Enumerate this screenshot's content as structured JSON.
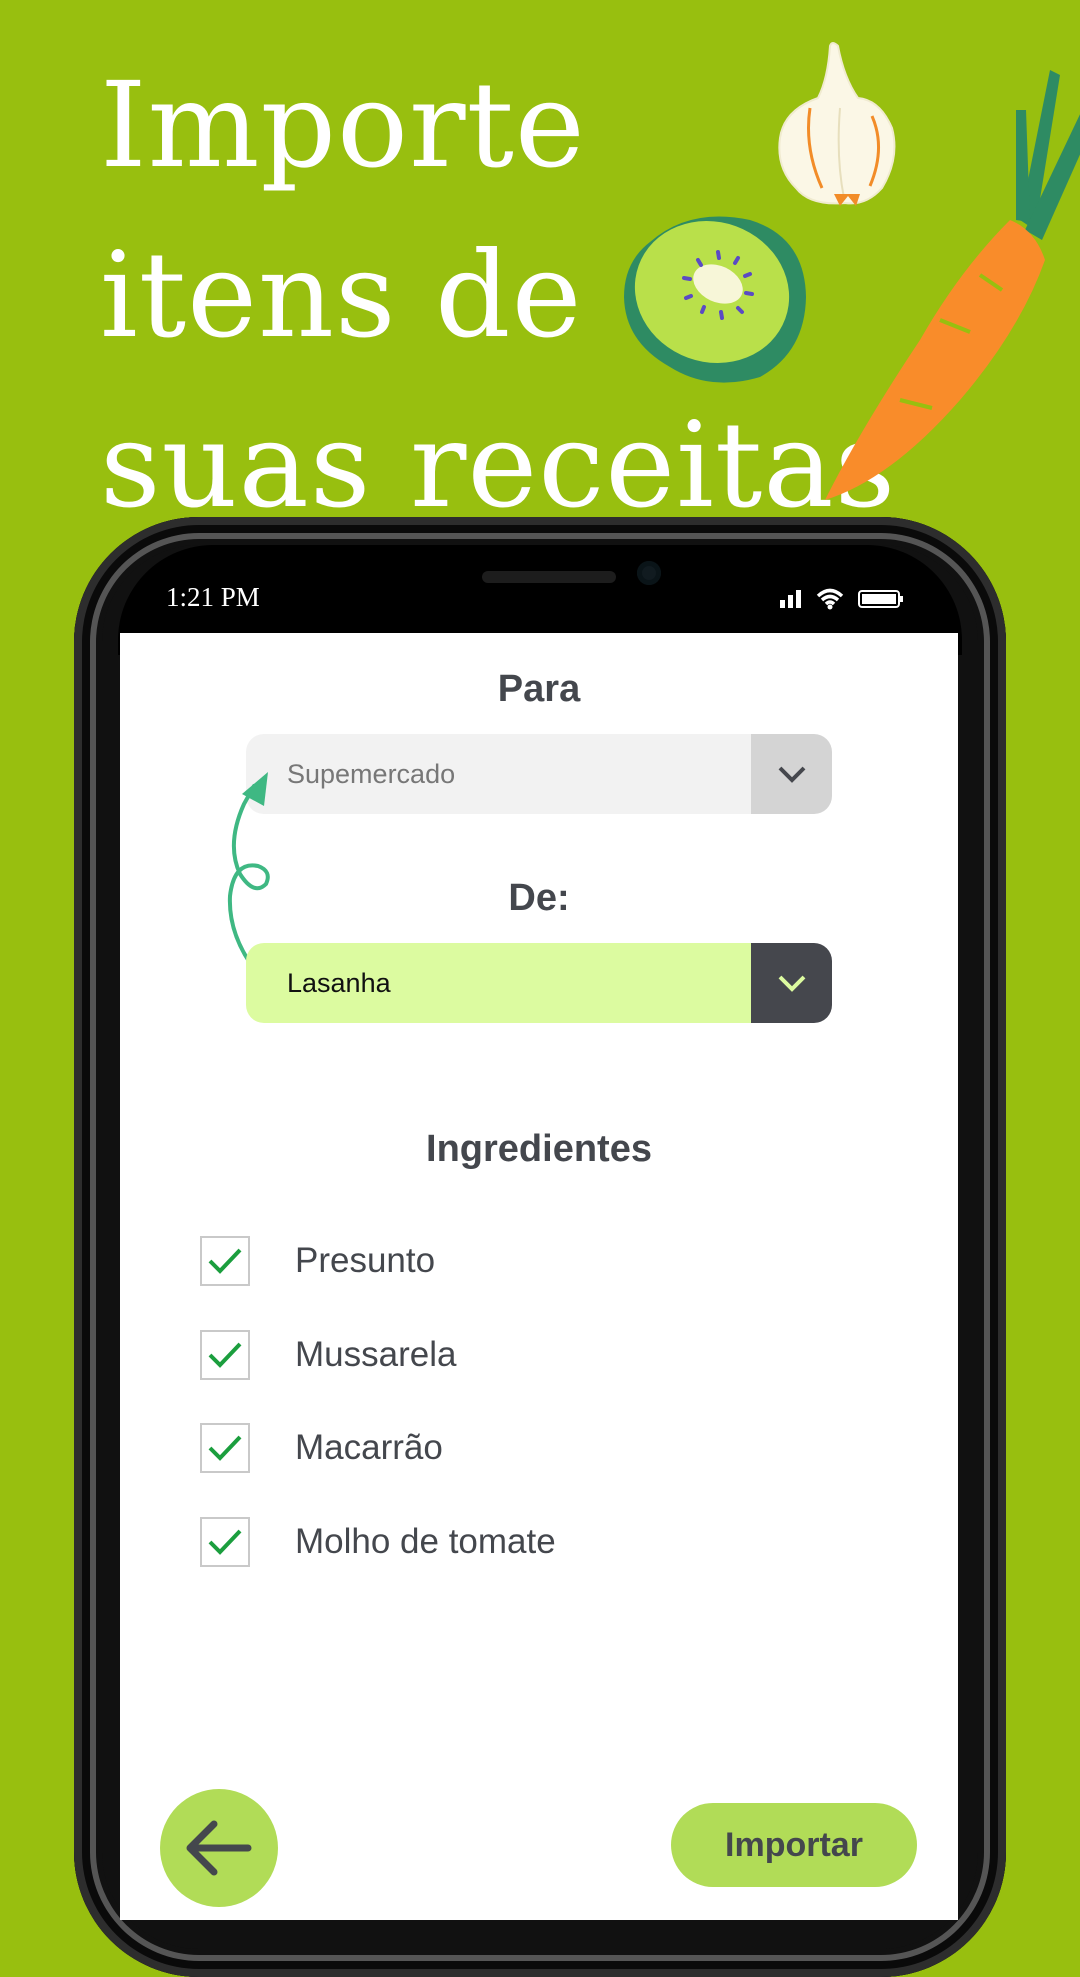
{
  "headline": {
    "line1": "Importe",
    "line2": "itens de",
    "line3": "suas receitas"
  },
  "status_bar": {
    "time": "1:21 PM"
  },
  "form": {
    "to_label": "Para",
    "to_value": "Supemercado",
    "from_label": "De:",
    "from_value": "Lasanha"
  },
  "ingredients": {
    "title": "Ingredientes",
    "items": [
      {
        "label": "Presunto",
        "checked": true
      },
      {
        "label": "Mussarela",
        "checked": true
      },
      {
        "label": "Macarrão",
        "checked": true
      },
      {
        "label": "Molho de tomate",
        "checked": true
      }
    ]
  },
  "actions": {
    "import_label": "Importar"
  },
  "colors": {
    "background": "#98bf0f",
    "accent": "#b1dc57",
    "selected_field": "#dcfba0",
    "text_dark": "#44474d",
    "check": "#1b9e3e",
    "arrow": "#3fb883"
  },
  "icons": {
    "back": "arrow-left-icon",
    "dropdown": "chevron-down-icon",
    "check": "checkmark-icon",
    "signal": "signal-icon",
    "wifi": "wifi-icon",
    "battery": "battery-icon"
  }
}
